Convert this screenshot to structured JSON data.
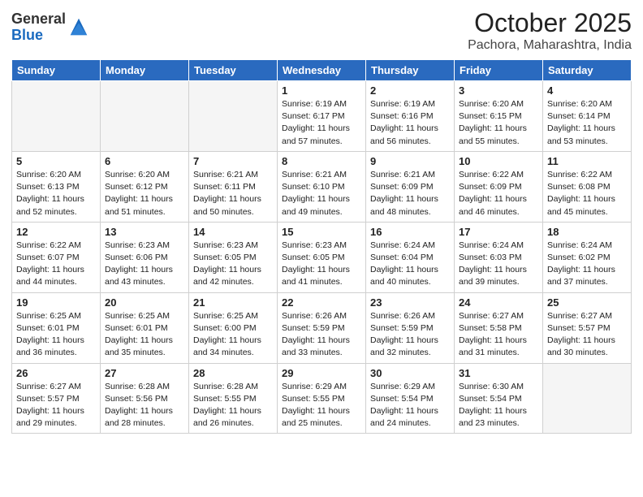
{
  "header": {
    "logo_general": "General",
    "logo_blue": "Blue",
    "month_title": "October 2025",
    "location": "Pachora, Maharashtra, India"
  },
  "weekdays": [
    "Sunday",
    "Monday",
    "Tuesday",
    "Wednesday",
    "Thursday",
    "Friday",
    "Saturday"
  ],
  "weeks": [
    [
      {
        "day": "",
        "info": ""
      },
      {
        "day": "",
        "info": ""
      },
      {
        "day": "",
        "info": ""
      },
      {
        "day": "1",
        "info": "Sunrise: 6:19 AM\nSunset: 6:17 PM\nDaylight: 11 hours\nand 57 minutes."
      },
      {
        "day": "2",
        "info": "Sunrise: 6:19 AM\nSunset: 6:16 PM\nDaylight: 11 hours\nand 56 minutes."
      },
      {
        "day": "3",
        "info": "Sunrise: 6:20 AM\nSunset: 6:15 PM\nDaylight: 11 hours\nand 55 minutes."
      },
      {
        "day": "4",
        "info": "Sunrise: 6:20 AM\nSunset: 6:14 PM\nDaylight: 11 hours\nand 53 minutes."
      }
    ],
    [
      {
        "day": "5",
        "info": "Sunrise: 6:20 AM\nSunset: 6:13 PM\nDaylight: 11 hours\nand 52 minutes."
      },
      {
        "day": "6",
        "info": "Sunrise: 6:20 AM\nSunset: 6:12 PM\nDaylight: 11 hours\nand 51 minutes."
      },
      {
        "day": "7",
        "info": "Sunrise: 6:21 AM\nSunset: 6:11 PM\nDaylight: 11 hours\nand 50 minutes."
      },
      {
        "day": "8",
        "info": "Sunrise: 6:21 AM\nSunset: 6:10 PM\nDaylight: 11 hours\nand 49 minutes."
      },
      {
        "day": "9",
        "info": "Sunrise: 6:21 AM\nSunset: 6:09 PM\nDaylight: 11 hours\nand 48 minutes."
      },
      {
        "day": "10",
        "info": "Sunrise: 6:22 AM\nSunset: 6:09 PM\nDaylight: 11 hours\nand 46 minutes."
      },
      {
        "day": "11",
        "info": "Sunrise: 6:22 AM\nSunset: 6:08 PM\nDaylight: 11 hours\nand 45 minutes."
      }
    ],
    [
      {
        "day": "12",
        "info": "Sunrise: 6:22 AM\nSunset: 6:07 PM\nDaylight: 11 hours\nand 44 minutes."
      },
      {
        "day": "13",
        "info": "Sunrise: 6:23 AM\nSunset: 6:06 PM\nDaylight: 11 hours\nand 43 minutes."
      },
      {
        "day": "14",
        "info": "Sunrise: 6:23 AM\nSunset: 6:05 PM\nDaylight: 11 hours\nand 42 minutes."
      },
      {
        "day": "15",
        "info": "Sunrise: 6:23 AM\nSunset: 6:05 PM\nDaylight: 11 hours\nand 41 minutes."
      },
      {
        "day": "16",
        "info": "Sunrise: 6:24 AM\nSunset: 6:04 PM\nDaylight: 11 hours\nand 40 minutes."
      },
      {
        "day": "17",
        "info": "Sunrise: 6:24 AM\nSunset: 6:03 PM\nDaylight: 11 hours\nand 39 minutes."
      },
      {
        "day": "18",
        "info": "Sunrise: 6:24 AM\nSunset: 6:02 PM\nDaylight: 11 hours\nand 37 minutes."
      }
    ],
    [
      {
        "day": "19",
        "info": "Sunrise: 6:25 AM\nSunset: 6:01 PM\nDaylight: 11 hours\nand 36 minutes."
      },
      {
        "day": "20",
        "info": "Sunrise: 6:25 AM\nSunset: 6:01 PM\nDaylight: 11 hours\nand 35 minutes."
      },
      {
        "day": "21",
        "info": "Sunrise: 6:25 AM\nSunset: 6:00 PM\nDaylight: 11 hours\nand 34 minutes."
      },
      {
        "day": "22",
        "info": "Sunrise: 6:26 AM\nSunset: 5:59 PM\nDaylight: 11 hours\nand 33 minutes."
      },
      {
        "day": "23",
        "info": "Sunrise: 6:26 AM\nSunset: 5:59 PM\nDaylight: 11 hours\nand 32 minutes."
      },
      {
        "day": "24",
        "info": "Sunrise: 6:27 AM\nSunset: 5:58 PM\nDaylight: 11 hours\nand 31 minutes."
      },
      {
        "day": "25",
        "info": "Sunrise: 6:27 AM\nSunset: 5:57 PM\nDaylight: 11 hours\nand 30 minutes."
      }
    ],
    [
      {
        "day": "26",
        "info": "Sunrise: 6:27 AM\nSunset: 5:57 PM\nDaylight: 11 hours\nand 29 minutes."
      },
      {
        "day": "27",
        "info": "Sunrise: 6:28 AM\nSunset: 5:56 PM\nDaylight: 11 hours\nand 28 minutes."
      },
      {
        "day": "28",
        "info": "Sunrise: 6:28 AM\nSunset: 5:55 PM\nDaylight: 11 hours\nand 26 minutes."
      },
      {
        "day": "29",
        "info": "Sunrise: 6:29 AM\nSunset: 5:55 PM\nDaylight: 11 hours\nand 25 minutes."
      },
      {
        "day": "30",
        "info": "Sunrise: 6:29 AM\nSunset: 5:54 PM\nDaylight: 11 hours\nand 24 minutes."
      },
      {
        "day": "31",
        "info": "Sunrise: 6:30 AM\nSunset: 5:54 PM\nDaylight: 11 hours\nand 23 minutes."
      },
      {
        "day": "",
        "info": ""
      }
    ]
  ]
}
